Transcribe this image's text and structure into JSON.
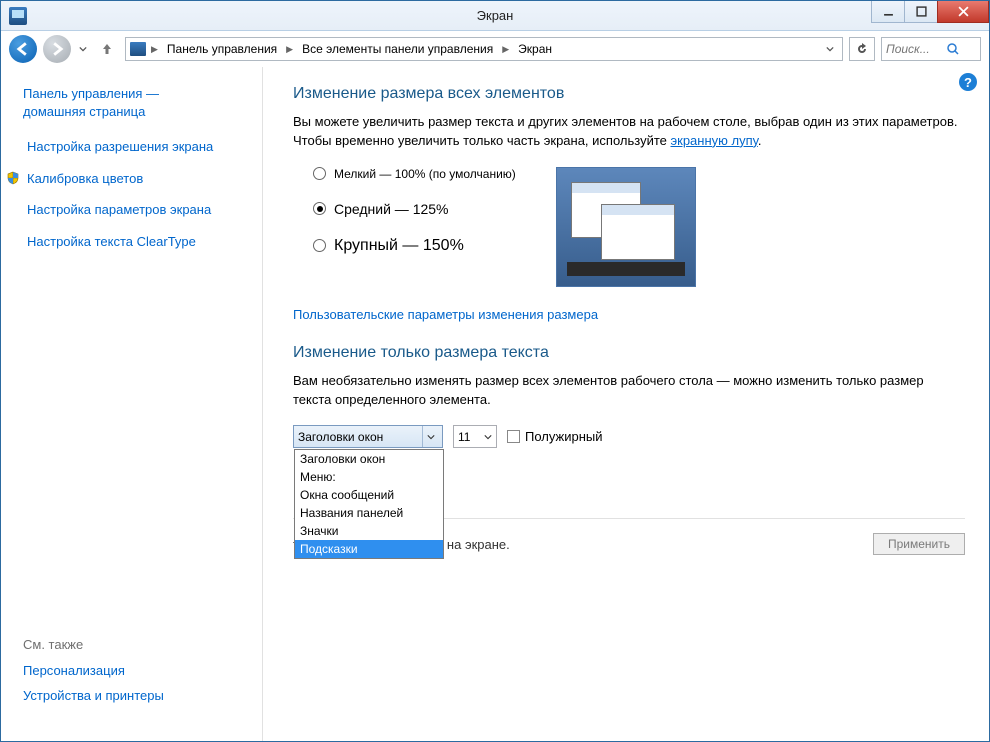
{
  "titlebar": {
    "title": "Экран"
  },
  "nav": {
    "breadcrumbs": [
      "Панель управления",
      "Все элементы панели управления",
      "Экран"
    ],
    "search_placeholder": "Поиск..."
  },
  "sidebar": {
    "home_line1": "Панель управления —",
    "home_line2": "домашняя страница",
    "links": [
      {
        "label": "Настройка разрешения экрана",
        "shield": false
      },
      {
        "label": "Калибровка цветов",
        "shield": true
      },
      {
        "label": "Настройка параметров экрана",
        "shield": false
      },
      {
        "label": "Настройка текста ClearType",
        "shield": false
      }
    ],
    "footer_header": "См. также",
    "footer_links": [
      "Персонализация",
      "Устройства и принтеры"
    ]
  },
  "content": {
    "section1_title": "Изменение размера всех элементов",
    "section1_desc_prefix": "Вы можете увеличить размер текста и других элементов на рабочем столе, выбрав один из этих параметров. Чтобы временно увеличить только часть экрана, используйте ",
    "section1_desc_link": "экранную лупу",
    "section1_desc_suffix": ".",
    "size_options": [
      {
        "label": "Мелкий — 100% (по умолчанию)",
        "checked": false,
        "cls": "small"
      },
      {
        "label": "Средний — 125%",
        "checked": true,
        "cls": "medium"
      },
      {
        "label": "Крупный — 150%",
        "checked": false,
        "cls": "large"
      }
    ],
    "custom_link": "Пользовательские параметры изменения размера",
    "section2_title": "Изменение только размера текста",
    "section2_desc": "Вам необязательно изменять размер всех элементов рабочего стола — можно изменить только размер текста определенного элемента.",
    "element_combo_value": "Заголовки окон",
    "element_combo_options": [
      "Заголовки окон",
      "Меню:",
      "Окна сообщений",
      "Названия панелей",
      "Значки",
      "Подсказки"
    ],
    "element_combo_highlighted": "Подсказки",
    "font_size_value": "11",
    "bold_label": "Полужирный",
    "truncated_note": "ты могут не поместиться на экране.",
    "apply_label": "Применить"
  }
}
